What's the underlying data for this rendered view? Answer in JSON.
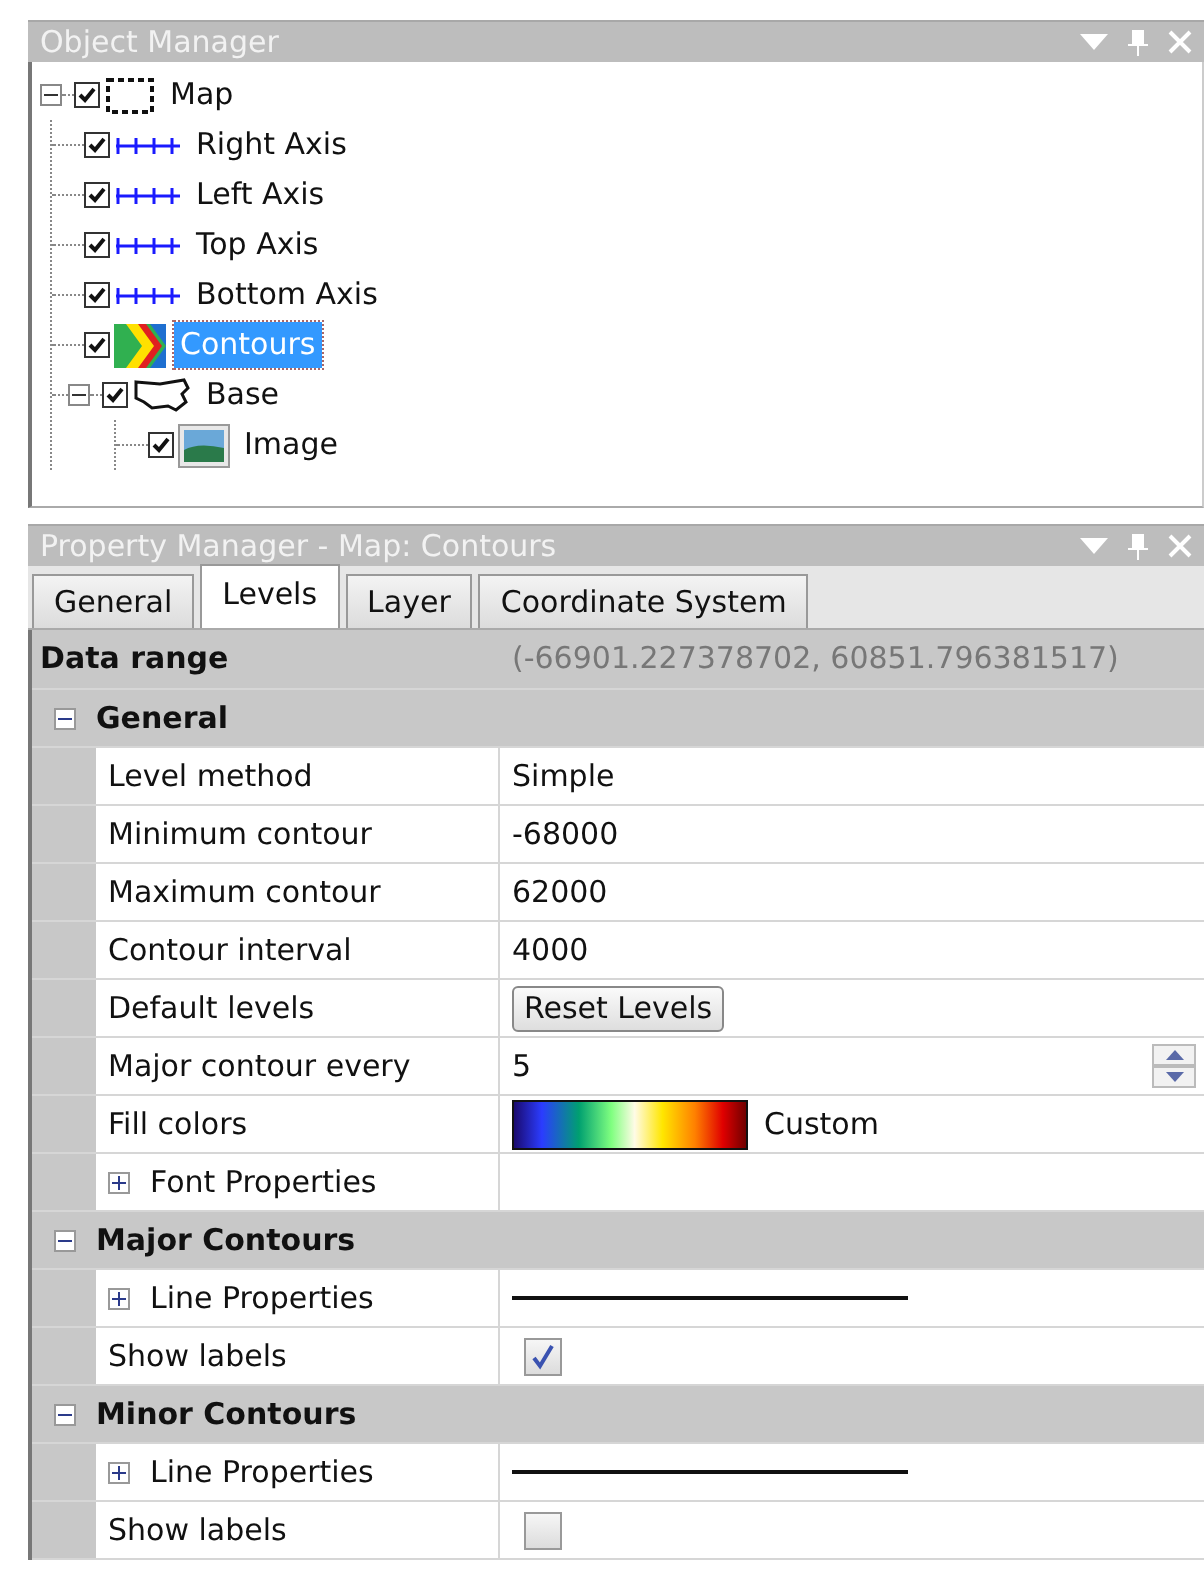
{
  "object_manager": {
    "title": "Object Manager",
    "tree": [
      {
        "label": "Map",
        "kind": "frame",
        "checked": true,
        "expanded": true,
        "selected": false,
        "children": [
          {
            "label": "Right Axis",
            "kind": "axis",
            "checked": true,
            "selected": false
          },
          {
            "label": "Left Axis",
            "kind": "axis",
            "checked": true,
            "selected": false
          },
          {
            "label": "Top Axis",
            "kind": "axis",
            "checked": true,
            "selected": false
          },
          {
            "label": "Bottom Axis",
            "kind": "axis",
            "checked": true,
            "selected": false
          },
          {
            "label": "Contours",
            "kind": "contour",
            "checked": true,
            "selected": true
          },
          {
            "label": "Base",
            "kind": "outline",
            "checked": true,
            "expanded": true,
            "selected": false,
            "children": [
              {
                "label": "Image",
                "kind": "image",
                "checked": true,
                "selected": false
              }
            ]
          }
        ]
      }
    ]
  },
  "property_manager": {
    "title": "Property Manager - Map: Contours",
    "tabs": [
      {
        "label": "General",
        "selected": false
      },
      {
        "label": "Levels",
        "selected": true
      },
      {
        "label": "Layer",
        "selected": false
      },
      {
        "label": "Coordinate System",
        "selected": false
      }
    ],
    "data_range": {
      "label": "Data range",
      "value": "(-66901.227378702, 60851.796381517)"
    },
    "sections": [
      {
        "title": "General",
        "expanded": true,
        "rows": [
          {
            "kind": "text",
            "label": "Level method",
            "value": "Simple"
          },
          {
            "kind": "text",
            "label": "Minimum contour",
            "value": "-68000"
          },
          {
            "kind": "text",
            "label": "Maximum contour",
            "value": "62000"
          },
          {
            "kind": "text",
            "label": "Contour interval",
            "value": "4000"
          },
          {
            "kind": "button",
            "label": "Default levels",
            "value": "Reset Levels"
          },
          {
            "kind": "spinner",
            "label": "Major contour every",
            "value": "5"
          },
          {
            "kind": "gradient",
            "label": "Fill colors",
            "value": "Custom"
          },
          {
            "kind": "group",
            "label": "Font Properties",
            "expanded": false
          }
        ]
      },
      {
        "title": "Major Contours",
        "expanded": true,
        "rows": [
          {
            "kind": "line",
            "label": "Line Properties",
            "expanded": false
          },
          {
            "kind": "checkbox",
            "label": "Show labels",
            "checked": true
          }
        ]
      },
      {
        "title": "Minor Contours",
        "expanded": true,
        "rows": [
          {
            "kind": "line",
            "label": "Line Properties",
            "expanded": false
          },
          {
            "kind": "checkbox",
            "label": "Show labels",
            "checked": false
          }
        ]
      }
    ]
  }
}
